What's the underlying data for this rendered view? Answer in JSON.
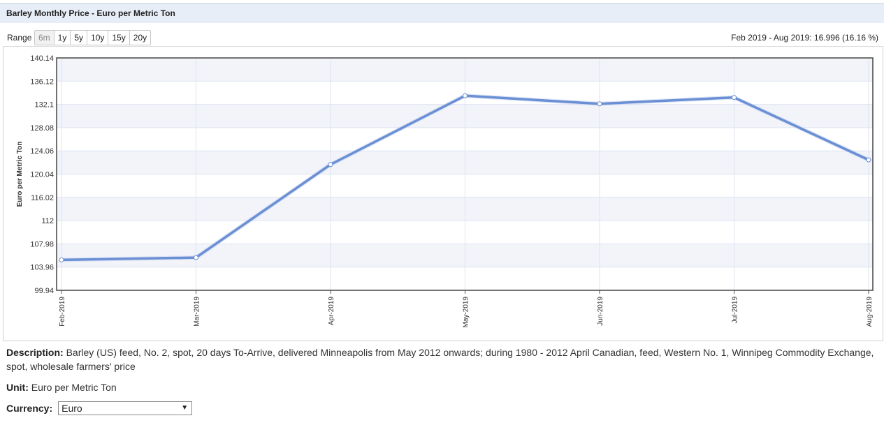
{
  "header": {
    "title": "Barley Monthly Price - Euro per Metric Ton"
  },
  "range": {
    "label": "Range",
    "buttons": [
      "6m",
      "1y",
      "5y",
      "10y",
      "15y",
      "20y"
    ],
    "summary": "Feb 2019 - Aug 2019: 16.996 (16.16 %)"
  },
  "description": {
    "label": "Description:",
    "text": "Barley (US) feed, No. 2, spot, 20 days To-Arrive, delivered Minneapolis from May 2012 onwards; during 1980 - 2012 April Canadian, feed, Western No. 1, Winnipeg Commodity Exchange, spot, wholesale farmers' price"
  },
  "unit": {
    "label": "Unit:",
    "text": "Euro per Metric Ton"
  },
  "currency": {
    "label": "Currency:",
    "selected": "Euro"
  },
  "colors": {
    "line": "#6a8fd4",
    "band": "#f2f4fa",
    "grid": "#dde3f0",
    "frame": "#444444"
  },
  "chart_data": {
    "type": "line",
    "title": "",
    "xlabel": "",
    "ylabel": "Euro per Metric Ton",
    "categories": [
      "Feb-2019",
      "Mar-2019",
      "Apr-2019",
      "May-2019",
      "Jun-2019",
      "Jul-2019",
      "Aug-2019"
    ],
    "series": [
      {
        "values": [
          105.2,
          105.6,
          121.7,
          133.6,
          132.2,
          133.3,
          122.5
        ]
      }
    ],
    "yticks": [
      "140.14",
      "136.12",
      "132.1",
      "128.08",
      "124.06",
      "120.04",
      "116.02",
      "112",
      "107.98",
      "103.96",
      "99.94"
    ],
    "ylim": [
      99.94,
      140.14
    ],
    "grid": true,
    "legend": "none"
  }
}
